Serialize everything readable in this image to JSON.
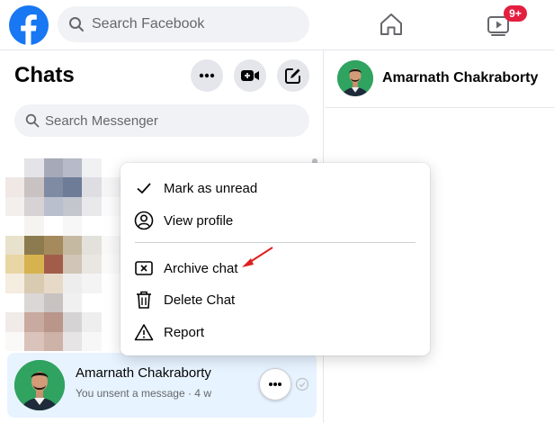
{
  "topbar": {
    "search_placeholder": "Search Facebook",
    "watch_badge": "9+"
  },
  "chats": {
    "title": "Chats",
    "search_placeholder": "Search Messenger",
    "active_chat": {
      "name": "Amarnath Chakraborty",
      "snippet": "You unsent a message · 4 w"
    }
  },
  "conversation": {
    "name": "Amarnath Chakraborty"
  },
  "context_menu": {
    "items": [
      {
        "label": "Mark as unread",
        "icon": "check-icon"
      },
      {
        "label": "View profile",
        "icon": "user-circle-icon"
      },
      {
        "label": "Archive chat",
        "icon": "archive-x-icon"
      },
      {
        "label": "Delete Chat",
        "icon": "trash-icon"
      },
      {
        "label": "Report",
        "icon": "warning-icon"
      }
    ]
  },
  "colors": {
    "brand": "#1877f2",
    "badge": "#e41e3f",
    "active_row": "#e7f3ff",
    "annotation_arrow": "#e02020"
  }
}
